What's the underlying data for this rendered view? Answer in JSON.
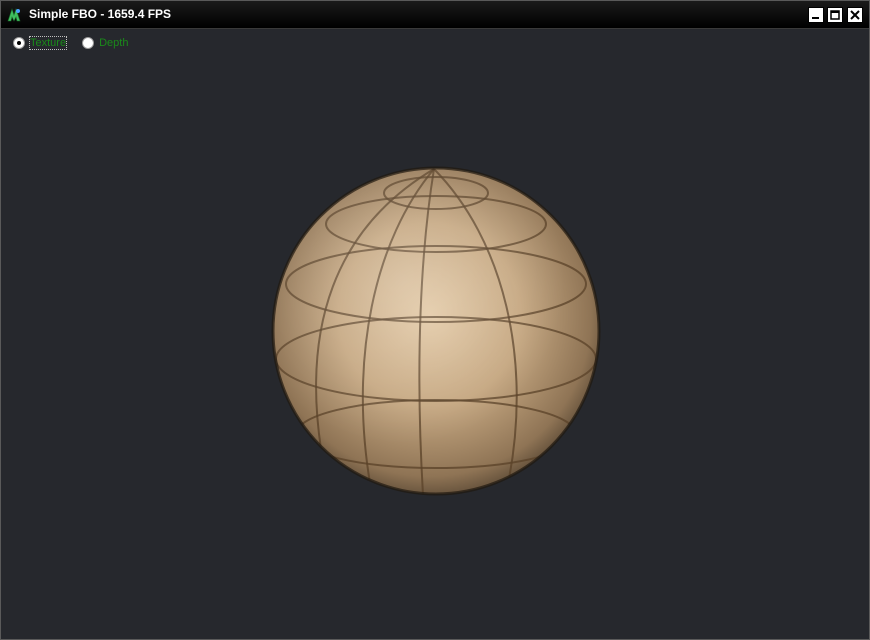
{
  "window": {
    "title": "Simple FBO - 1659.4 FPS",
    "controls": [
      "minimize-icon",
      "maximize-icon",
      "close-icon"
    ]
  },
  "render_mode": {
    "options": [
      {
        "label": "Texture",
        "selected": true
      },
      {
        "label": "Depth",
        "selected": false
      }
    ]
  },
  "scene": {
    "background_color": "#26282d",
    "object": "textured-sphere",
    "sphere_color": "#c6a882",
    "line_color": "#5a4228",
    "label_color": "#1a8a1a"
  }
}
